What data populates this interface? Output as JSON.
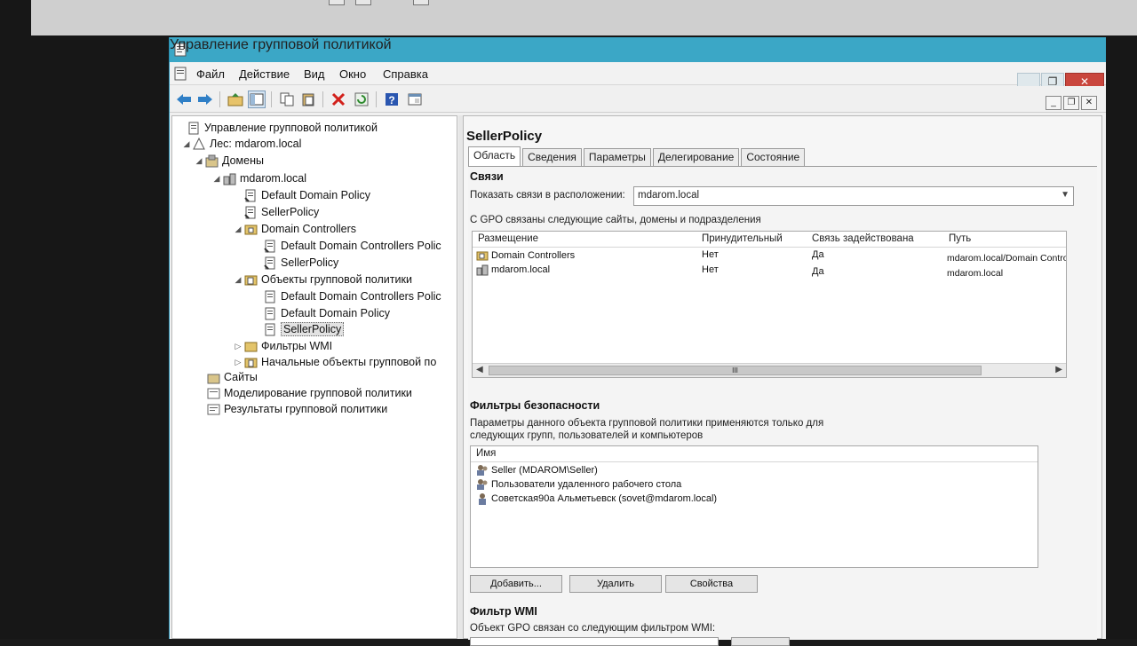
{
  "window": {
    "title": "Управление групповой политикой"
  },
  "menu": [
    "Файл",
    "Действие",
    "Вид",
    "Окно",
    "Справка"
  ],
  "tree": {
    "items": [
      {
        "label": "Управление групповой политикой"
      },
      {
        "label": "Лес: mdarom.local"
      },
      {
        "label": "Домены"
      },
      {
        "label": "mdarom.local"
      },
      {
        "label": "Default Domain Policy"
      },
      {
        "label": "SellerPolicy"
      },
      {
        "label": "Domain Controllers"
      },
      {
        "label": "Default Domain Controllers Polic"
      },
      {
        "label": "SellerPolicy"
      },
      {
        "label": "Объекты групповой политики"
      },
      {
        "label": "Default Domain Controllers Polic"
      },
      {
        "label": "Default Domain Policy"
      },
      {
        "label": "SellerPolicy"
      },
      {
        "label": "Фильтры WMI"
      },
      {
        "label": "Начальные объекты групповой по"
      },
      {
        "label": "Сайты"
      },
      {
        "label": "Моделирование групповой политики"
      },
      {
        "label": "Результаты групповой политики"
      }
    ]
  },
  "details": {
    "title": "SellerPolicy",
    "tabs": [
      "Область",
      "Сведения",
      "Параметры",
      "Делегирование",
      "Состояние"
    ],
    "links": {
      "heading": "Связи",
      "show_links_label": "Показать связи в расположении:",
      "location_value": "mdarom.local",
      "description": "С GPO связаны следующие сайты, домены и подразделения",
      "columns": [
        "Размещение",
        "Принудительный",
        "Связь задействована",
        "Путь"
      ],
      "rows": [
        {
          "location": "Domain Controllers",
          "enforced": "Нет",
          "enabled": "Да",
          "path": "mdarom.local/Domain Controlle"
        },
        {
          "location": "mdarom.local",
          "enforced": "Нет",
          "enabled": "Да",
          "path": "mdarom.local"
        }
      ],
      "scroll_grip": "III"
    },
    "security": {
      "heading": "Фильтры безопасности",
      "description_line1": "Параметры данного объекта групповой политики применяются только для",
      "description_line2": "следующих групп, пользователей и компьютеров",
      "column": "Имя",
      "rows": [
        "Seller (MDAROM\\Seller)",
        "Пользователи удаленного рабочего стола",
        "Советская90а Альметьевск (sovet@mdarom.local)"
      ],
      "buttons": {
        "add": "Добавить...",
        "remove": "Удалить",
        "properties": "Свойства"
      }
    },
    "wmi": {
      "heading": "Фильтр WMI",
      "description": "Объект GPO связан со следующим фильтром WMI:"
    }
  }
}
